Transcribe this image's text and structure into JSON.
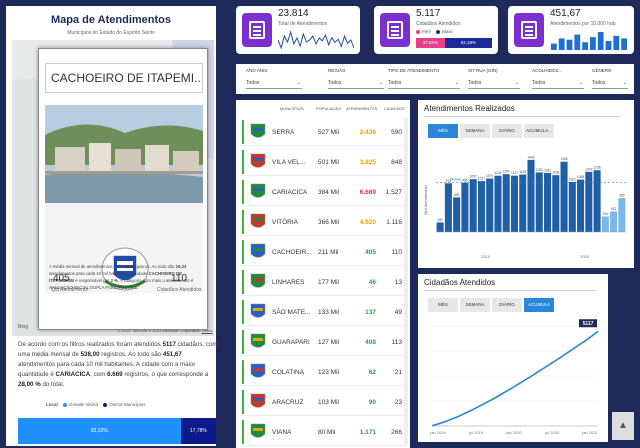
{
  "left": {
    "title": "Mapa de Atendimentos",
    "subtitle": "Municípios do Estado do Espírito Santo",
    "credit": "© 2021 TomTom © 2021 Microsoft Corporation",
    "terms": "Terms",
    "bing": "Bing",
    "popup": {
      "city": "CACHOEIRO DE ITAPEMI...",
      "left_value": "405",
      "left_label": "Qtd Atendimento",
      "right_value": "110",
      "right_label": "Cidadãos Atendidos",
      "p1": "A média mensal de atendimentos é de",
      "p1b": "8,10",
      "p1c": "registros. Ao todo são",
      "p2b": "19,23",
      "p2c": "atendimentos para cada 10 mil habitantes. A cidade",
      "p3b": "CACHOEIRO DE ITAPEMIRIM",
      "p3c": "é responsável por",
      "p3d": "2 %",
      "p3e": ". A categoria com mais o atendimento é AVALIAÇÃO INICIAL DUPLA PSICOSSOCIAL."
    },
    "summary": {
      "a": "De acordo com os filtros realizados foram atendidos",
      "b": "5117",
      "c": "cidadãos, com uma média mensal de",
      "d": "538,00",
      "e": "registros. Ao todo são",
      "f": "451,67",
      "g": "atendimentos para cada 10 mil habitantes. A cidade com a maior quantidade é",
      "h": "CARIACICA",
      "i": ", com",
      "j": "6.669",
      "k": "registros, o que corresponde a",
      "l": "28,00 %",
      "m": "do total."
    },
    "legend": {
      "title": "Local",
      "a": "Grande Vitória",
      "b": "Outros Municípios",
      "color_a": "#1e90ff",
      "color_b": "#0c1a8a"
    },
    "split": {
      "a_label": "82,22%",
      "a_frac": 0.8222,
      "b_label": "17,78%"
    },
    "toolbar": [
      "+",
      "−",
      "◎",
      "⌂",
      "▦"
    ]
  },
  "kpis": [
    {
      "value": "23.814",
      "label": "Total de Atendimentos"
    },
    {
      "value": "5.117",
      "label": "Cidadãos Atendidos",
      "fem": "Fem",
      "masc": "Masc",
      "fem_pct": "37,82%",
      "masc_pct": "62,18%",
      "fem_frac": 0.3782,
      "fem_color": "#e83e8c",
      "masc_color": "#1e2a9a"
    },
    {
      "value": "451,67",
      "label": "Atendimentos por 10.000 hab"
    }
  ],
  "kpi_sparks": {
    "line": [
      60,
      40,
      70,
      55,
      80,
      50,
      65,
      45,
      75,
      55,
      60,
      70,
      50,
      65,
      58,
      72,
      48,
      66,
      54,
      62,
      44,
      70,
      52,
      60,
      40
    ],
    "bars": [
      5,
      9,
      8,
      12,
      6,
      10,
      14,
      7,
      11,
      9
    ]
  },
  "filters": [
    {
      "label": "ANO ANIS",
      "value": "Todos"
    },
    {
      "label": "REGIÃO",
      "value": "Todos"
    },
    {
      "label": "TIPO DE ATENDIMENTO",
      "value": "Todos"
    },
    {
      "label": "SIT RUA (GIN)",
      "value": "Todos"
    },
    {
      "label": "ACOLHIDOS...",
      "value": "Todos"
    },
    {
      "label": "GÊNERO",
      "value": "Todos"
    }
  ],
  "table": {
    "headers": [
      "MUNICÍPIOS",
      "POPULAÇÃO",
      "ATENDIMENTOS",
      "CIDADÃOS"
    ],
    "rows": [
      {
        "name": "SERRA",
        "pop": "527 Mil",
        "att": "2.436",
        "cid": "590",
        "att_color": "#e0a800",
        "c1": "#1e8c3a",
        "c2": "#2a5fbf"
      },
      {
        "name": "VILA VEL...",
        "pop": "501 Mil",
        "att": "3.825",
        "cid": "848",
        "att_color": "#e0a800",
        "c1": "#c0392b",
        "c2": "#2a5fbf"
      },
      {
        "name": "CARIACICA",
        "pop": "384 Mil",
        "att": "6.669",
        "cid": "1.527",
        "att_color": "#d9362b",
        "c1": "#1e8c3a",
        "c2": "#2a5fbf"
      },
      {
        "name": "VITÓRIA",
        "pop": "366 Mil",
        "att": "4.920",
        "cid": "1.116",
        "att_color": "#e0a800",
        "c1": "#c0392b",
        "c2": "#1e8c3a"
      },
      {
        "name": "CACHOEIR...",
        "pop": "211 Mil",
        "att": "405",
        "cid": "110",
        "att_color": "#2ea043",
        "c1": "#2a5fbf",
        "c2": "#1e8c3a"
      },
      {
        "name": "LINHARES",
        "pop": "177 Mil",
        "att": "46",
        "cid": "13",
        "att_color": "#2ea043",
        "c1": "#1e8c3a",
        "c2": "#c0392b"
      },
      {
        "name": "SÃO MATE...",
        "pop": "133 Mil",
        "att": "137",
        "cid": "49",
        "att_color": "#2ea043",
        "c1": "#2a5fbf",
        "c2": "#e0a800"
      },
      {
        "name": "GUARAPARI",
        "pop": "127 Mil",
        "att": "408",
        "cid": "113",
        "att_color": "#2ea043",
        "c1": "#1e8c3a",
        "c2": "#e0a800"
      },
      {
        "name": "COLATINA",
        "pop": "123 Mil",
        "att": "62",
        "cid": "21",
        "att_color": "#2ea043",
        "c1": "#2a5fbf",
        "c2": "#c0392b"
      },
      {
        "name": "ARACRUZ",
        "pop": "103 Mil",
        "att": "90",
        "cid": "23",
        "att_color": "#2ea043",
        "c1": "#c0392b",
        "c2": "#2a5fbf"
      },
      {
        "name": "VIANA",
        "pop": "80 Mil",
        "att": "1.171",
        "cid": "266",
        "att_color": "#2ea043",
        "c1": "#1e8c3a",
        "c2": "#e0a800"
      }
    ]
  },
  "chart_data": [
    {
      "type": "bar",
      "title": "Atendimentos Realizados",
      "buttons": [
        "MÊS",
        "SEMANA",
        "DIÁRIO",
        "ACUMULA..."
      ],
      "active": 0,
      "ylabel": "Qtd Atendimento",
      "mean_label": "Média",
      "values": [
        191,
        974,
        692,
        985,
        1057,
        1017,
        1070,
        1126,
        1157,
        1127,
        1149,
        1443,
        1192,
        1181,
        1136,
        1406,
        1001,
        1049,
        1202,
        1236,
        310,
        412,
        680
      ],
      "value_labels": [
        "191",
        "974",
        "692",
        "985",
        "1057",
        "1017",
        "1070",
        "1126",
        "1157",
        "1127",
        "1149",
        "1443",
        "1192",
        "1181",
        "1136",
        "1406",
        "1001",
        "1049",
        "1202",
        "1236",
        "310",
        "412",
        "680"
      ],
      "year_labels": [
        "2019",
        "2020"
      ],
      "color": "#1f5fa8",
      "highlight_color": "#7ab8e8"
    },
    {
      "type": "line",
      "title": "Cidadãos Atendidos",
      "buttons": [
        "MÊS",
        "SEMANA",
        "DIÁRIO",
        "ACUMULA"
      ],
      "active": 3,
      "x_ticks": [
        "jan 2019",
        "jul 2019",
        "jan 2020",
        "jul 2020",
        "jan 2021"
      ],
      "y": [
        10,
        120,
        240,
        380,
        520,
        690,
        860,
        1040,
        1230,
        1420,
        1620,
        1830,
        2040,
        2260,
        2480,
        2700,
        2930,
        3160,
        3390,
        3620,
        3860,
        4100,
        4340,
        4580,
        4840,
        5117
      ],
      "ylim": [
        0,
        5400
      ],
      "end_label": "5117",
      "color": "#2a86d9"
    }
  ]
}
